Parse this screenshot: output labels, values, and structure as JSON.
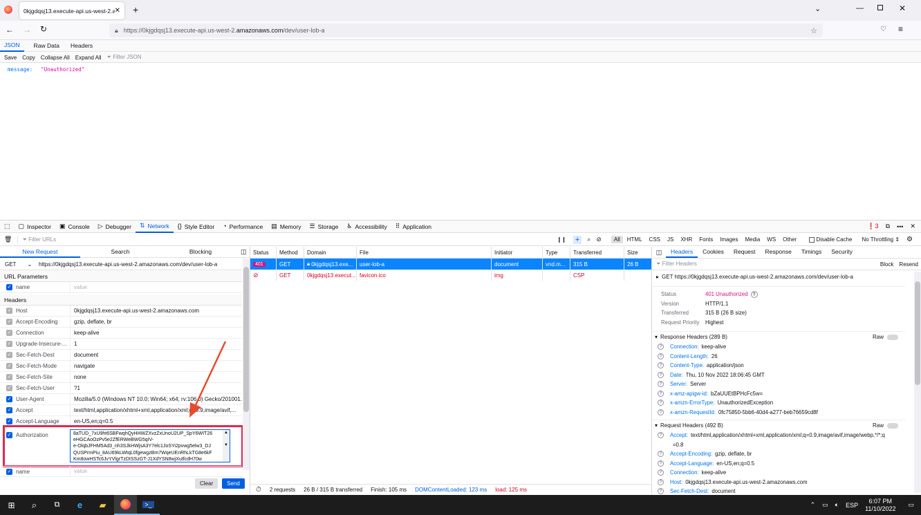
{
  "browser": {
    "tab_title": "0kjgdqsj13.execute-api.us-west-2.am",
    "url_prefix": "https://0kjgdqsj13.execute-api.us-west-2.",
    "url_domain": "amazonaws.com",
    "url_suffix": "/dev/user-lob-a"
  },
  "json_viewer": {
    "tabs": [
      "JSON",
      "Raw Data",
      "Headers"
    ],
    "tools": [
      "Save",
      "Copy",
      "Collapse All",
      "Expand All"
    ],
    "filter_placeholder": "Filter JSON",
    "key": "message:",
    "value": "\"Unauthorized\""
  },
  "devtools": {
    "tabs": [
      "Inspector",
      "Console",
      "Debugger",
      "Network",
      "Style Editor",
      "Performance",
      "Memory",
      "Storage",
      "Accessibility",
      "Application"
    ],
    "error_count": "3",
    "filter_placeholder": "Filter URLs",
    "type_filters": [
      "All",
      "HTML",
      "CSS",
      "JS",
      "XHR",
      "Fonts",
      "Images",
      "Media",
      "WS",
      "Other"
    ],
    "disable_cache": "Disable Cache",
    "throttling": "No Throttling"
  },
  "new_request": {
    "tabs": [
      "New Request",
      "Search",
      "Blocking"
    ],
    "method": "GET",
    "url": "https://0kjgdqsj13.execute-api.us-west-2.amazonaws.com/dev/user-lob-a",
    "url_params_label": "URL Parameters",
    "headers_label": "Headers",
    "name_placeholder": "name",
    "value_placeholder": "value",
    "headers": [
      {
        "name": "Host",
        "value": "0kjgdqsj13.execute-api.us-west-2.amazonaws.com",
        "on": false
      },
      {
        "name": "Accept-Encoding",
        "value": "gzip, deflate, br",
        "on": false
      },
      {
        "name": "Connection",
        "value": "keep-alive",
        "on": false
      },
      {
        "name": "Upgrade-Insecure-...",
        "value": "1",
        "on": false
      },
      {
        "name": "Sec-Fetch-Dest",
        "value": "document",
        "on": false
      },
      {
        "name": "Sec-Fetch-Mode",
        "value": "navigate",
        "on": false
      },
      {
        "name": "Sec-Fetch-Site",
        "value": "none",
        "on": false
      },
      {
        "name": "Sec-Fetch-User",
        "value": "?1",
        "on": false
      },
      {
        "name": "User-Agent",
        "value": "Mozilla/5.0 (Windows NT 10.0; Win64; x64; rv:106.0) Gecko/201001...",
        "on": true
      },
      {
        "name": "Accept",
        "value": "text/html,application/xhtml+xml,application/xml;q=0.9,image/avif,...",
        "on": true
      },
      {
        "name": "Accept-Language",
        "value": "en-US,en;q=0.5",
        "on": true
      }
    ],
    "auth_name": "Authorization",
    "auth_value_lines": [
      "8aTUD_7xU9ht6SBFwqhQyHHWZXvzZxUnoU2UP_SpY6WIT26",
      "eHGCAoOzPv5e2ZfERWeBWG5qIV-",
      "e-OlqbJFHM5Ad3_nh3SJkHWjsA3Y7elc1JoSYi2pvwg5elw3_DJ",
      "QUSPrmPiu_8AU69kLWtqL0fgewgzBm7WqeUEnRhLkTG8e6kF",
      "Km8owHSTc6JvYVlgrTzDISSzGT-J1XdYSN8wjXutfcdH70w"
    ],
    "clear_label": "Clear",
    "send_label": "Send"
  },
  "table": {
    "columns": [
      "Status",
      "Method",
      "Domain",
      "File",
      "Initiator",
      "Type",
      "Transferred",
      "Size"
    ],
    "rows": [
      {
        "status": "401",
        "method": "GET",
        "domain": "0kjgdqsj13.exe...",
        "file": "user-lob-a",
        "initiator": "document",
        "type": "vnd.m...",
        "transferred": "315 B",
        "size": "26 B"
      },
      {
        "status": "",
        "method": "GET",
        "domain": "0kjgdqsj13.execut...",
        "file": "favicon.ico",
        "initiator": "img",
        "type": "",
        "transferred": "CSP",
        "size": ""
      }
    ]
  },
  "status_bar": {
    "requests": "2 requests",
    "transferred": "26 B / 315 B transferred",
    "finish": "Finish: 105 ms",
    "dcl": "DOMContentLoaded: 123 ms",
    "load": "load: 125 ms"
  },
  "details": {
    "tabs": [
      "Headers",
      "Cookies",
      "Request",
      "Response",
      "Timings",
      "Security"
    ],
    "filter_placeholder": "Filter Headers",
    "block": "Block",
    "resend": "Resend",
    "request_line": "GET  https://0kjgdqsj13.execute-api.us-west-2.amazonaws.com/dev/user-lob-a",
    "summary": [
      {
        "k": "Status",
        "v": "401 Unauthorized"
      },
      {
        "k": "Version",
        "v": "HTTP/1.1"
      },
      {
        "k": "Transferred",
        "v": "315 B (26 B size)"
      },
      {
        "k": "Request Priority",
        "v": "Highest"
      }
    ],
    "response_title": "Response Headers (289 B)",
    "raw": "Raw",
    "response_headers": [
      {
        "k": "Connection:",
        "v": "keep-alive"
      },
      {
        "k": "Content-Length:",
        "v": "26"
      },
      {
        "k": "Content-Type:",
        "v": "application/json"
      },
      {
        "k": "Date:",
        "v": "Thu, 10 Nov 2022 18:06:45 GMT"
      },
      {
        "k": "Server:",
        "v": "Server"
      },
      {
        "k": "x-amz-apigw-id:",
        "v": "bZaUUEtBPHcFc5w="
      },
      {
        "k": "x-amzn-ErrorType:",
        "v": "UnauthorizedException"
      },
      {
        "k": "x-amzn-RequestId:",
        "v": "0fc75850-5bb6-40d4-a277-beb76659cd8f"
      }
    ],
    "request_title": "Request Headers (492 B)",
    "request_headers": [
      {
        "k": "Accept:",
        "v": "text/html,application/xhtml+xml,application/xml;q=0.9,image/avif,image/webp,*/*;q"
      },
      {
        "k": "",
        "v": "=0.8"
      },
      {
        "k": "Accept-Encoding:",
        "v": "gzip, deflate, br"
      },
      {
        "k": "Accept-Language:",
        "v": "en-US,en;q=0.5"
      },
      {
        "k": "Connection:",
        "v": "keep-alive"
      },
      {
        "k": "Host:",
        "v": "0kjgdqsj13.execute-api.us-west-2.amazonaws.com"
      },
      {
        "k": "Sec-Fetch-Dest:",
        "v": "document"
      }
    ]
  },
  "taskbar": {
    "lang": "ESP",
    "time": "6:07 PM",
    "date": "11/10/2022"
  },
  "colors": {
    "accent": "#0060df",
    "highlight": "#e22850",
    "badge": "#d7157b"
  }
}
